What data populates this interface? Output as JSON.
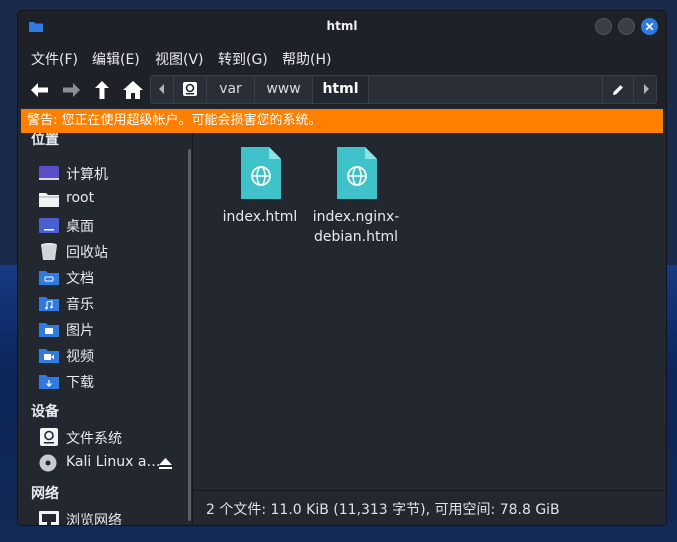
{
  "window": {
    "title": "html"
  },
  "menu": [
    "文件(F)",
    "编辑(E)",
    "视图(V)",
    "转到(G)",
    "帮助(H)"
  ],
  "path": {
    "crumbs": [
      "var",
      "www",
      "html"
    ]
  },
  "warning": "警告: 您正在使用超级帐户。可能会损害您的系统。",
  "sidebar": {
    "places_title": "位置",
    "places": [
      {
        "label": "计算机",
        "icon": "computer-icon"
      },
      {
        "label": "root",
        "icon": "home-folder-icon"
      },
      {
        "label": "桌面",
        "icon": "desktop-icon"
      },
      {
        "label": "回收站",
        "icon": "trash-icon"
      },
      {
        "label": "文档",
        "icon": "documents-folder-icon"
      },
      {
        "label": "音乐",
        "icon": "music-folder-icon"
      },
      {
        "label": "图片",
        "icon": "pictures-folder-icon"
      },
      {
        "label": "视频",
        "icon": "videos-folder-icon"
      },
      {
        "label": "下载",
        "icon": "downloads-folder-icon"
      }
    ],
    "devices_title": "设备",
    "devices": [
      {
        "label": "文件系统",
        "icon": "drive-icon"
      },
      {
        "label": "Kali Linux a…",
        "icon": "optical-disc-icon"
      }
    ],
    "network_title": "网络",
    "network": [
      {
        "label": "浏览网络",
        "icon": "network-icon"
      }
    ]
  },
  "files": [
    {
      "name_line1": "index.html",
      "name_line2": ""
    },
    {
      "name_line1": "index.nginx-",
      "name_line2": "debian.html"
    }
  ],
  "status": "2 个文件: 11.0 KiB (11,313 字节), 可用空间: 78.8 GiB",
  "colors": {
    "accent": "#2f7be0",
    "warning": "#ff7f00",
    "file_icon": "#3fc2c9"
  }
}
